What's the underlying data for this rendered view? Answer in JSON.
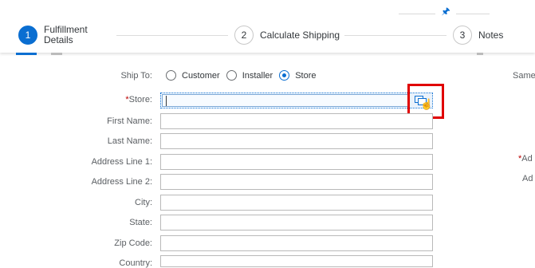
{
  "steps": [
    {
      "number": "1",
      "label_line1": "Fulfillment",
      "label_line2": "Details"
    },
    {
      "number": "2",
      "label": "Calculate Shipping"
    },
    {
      "number": "3",
      "label": "Notes"
    }
  ],
  "form": {
    "ship_to_label": "Ship To:",
    "ship_to_options": [
      "Customer",
      "Installer",
      "Store"
    ],
    "ship_to_selected": "Store",
    "store_req": "*",
    "store_label": "Store:",
    "first_name_label": "First Name:",
    "last_name_label": "Last Name:",
    "address1_label": "Address Line 1:",
    "address2_label": "Address Line 2:",
    "city_label": "City:",
    "state_label": "State:",
    "zip_label": "Zip Code:",
    "country_label": "Country:"
  },
  "right_cutoff": {
    "same": "Same",
    "ad_req": "*",
    "ad1": "Ad",
    "ad2": "Ad"
  },
  "icons": {
    "pin": "pin-icon",
    "value_help": "value-help-icon",
    "cursor": "hand-cursor-icon"
  },
  "colors": {
    "accent": "#0a6ed1",
    "highlight": "#e00000",
    "required": "#bb0000"
  }
}
